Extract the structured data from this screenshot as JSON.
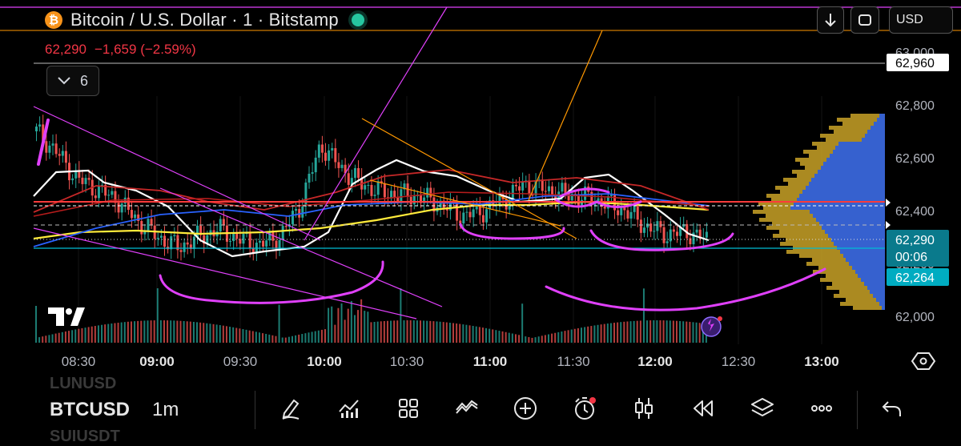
{
  "header": {
    "coin_symbol": "₿",
    "title": "Bitcoin / U.S. Dollar · 1 · Bitstamp",
    "last_price": "62,290",
    "change": "−1,659 (−2.59%)",
    "indicators_count": "6",
    "currency": "USD"
  },
  "price_axis": {
    "ticks": [
      "63,000",
      "62,800",
      "62,600",
      "62,400",
      "62,200",
      "62,000"
    ],
    "tick_values": [
      63000,
      62800,
      62600,
      62400,
      62200,
      62000
    ],
    "labels": {
      "high": "62,960",
      "current": "62,290",
      "countdown": "00:06",
      "lower": "62,264"
    }
  },
  "time_axis": {
    "ticks": [
      "08:30",
      "09:00",
      "09:30",
      "10:00",
      "10:30",
      "11:00",
      "11:30",
      "12:00",
      "12:30",
      "13:00"
    ],
    "bold": [
      false,
      true,
      false,
      true,
      false,
      true,
      false,
      true,
      false,
      true
    ]
  },
  "bottom": {
    "symbol_prev": "LUNUSD",
    "symbol": "BTCUSD",
    "symbol_next": "SUIUSDT",
    "timeframe": "1m"
  },
  "chart_data": {
    "type": "candlestick",
    "symbol": "BTCUSD",
    "interval": "1m",
    "ylim": [
      61930,
      63100
    ],
    "x_ticks": [
      "08:30",
      "09:00",
      "09:30",
      "10:00",
      "10:30",
      "11:00",
      "11:30",
      "12:00",
      "12:30",
      "13:00"
    ],
    "close_series": [
      62700,
      62620,
      62520,
      62480,
      62440,
      62360,
      62300,
      62260,
      62300,
      62330,
      62290,
      62270,
      62300,
      62420,
      62650,
      62560,
      62500,
      62470,
      62460,
      62450,
      62420,
      62380,
      62400,
      62440,
      62500,
      62480,
      62460,
      62450,
      62430,
      62400,
      62340,
      62310,
      62320,
      62290
    ],
    "colors": {
      "up": "#26a69a",
      "down": "#ef5350",
      "volume_profile_up": "#2f5fd9",
      "volume_profile_down": "#c9a227",
      "fast_ma": "#ffffff",
      "slow_ma": "#ffeb3b",
      "drawings": "#e040fb"
    }
  },
  "toolbar_icons": [
    "pencil-icon",
    "indicators-icon",
    "grid-icon",
    "trend-icon",
    "plus-icon",
    "alarm-icon",
    "candles-icon",
    "replay-icon",
    "layers-icon",
    "more-icon",
    "undo-icon"
  ]
}
